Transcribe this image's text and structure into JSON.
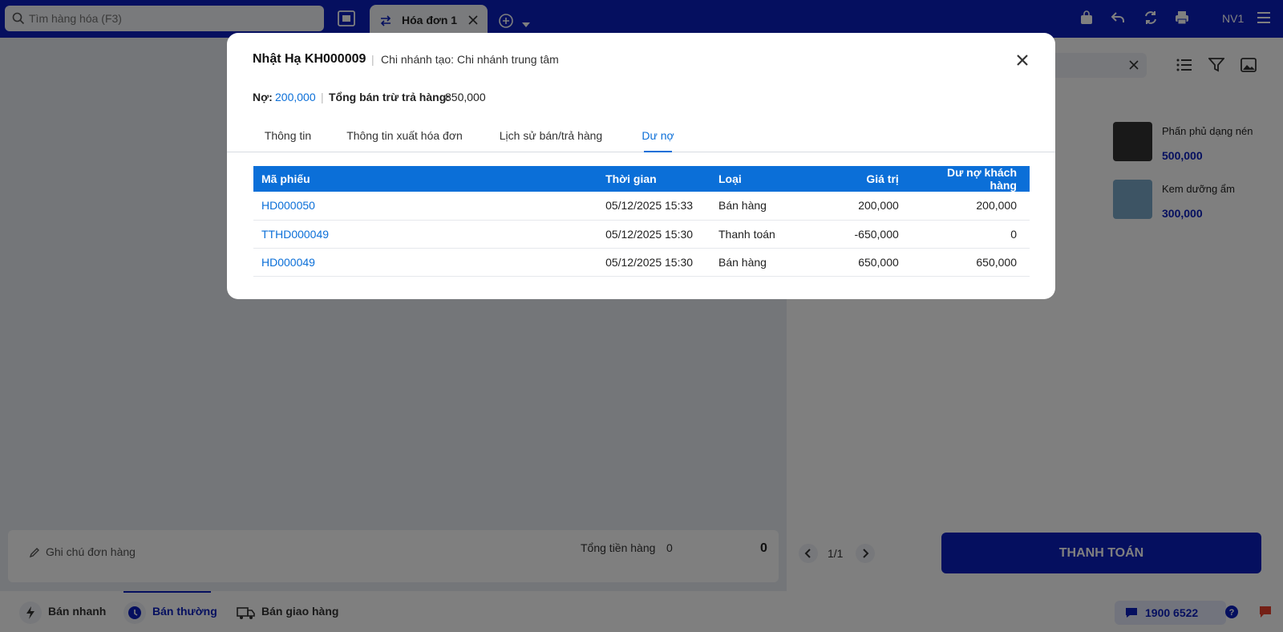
{
  "topbar": {
    "search_placeholder": "Tìm hàng hóa (F3)",
    "invoice_tab_label": "Hóa đơn 1",
    "user": "NV1"
  },
  "products": [
    {
      "name": "Phấn phủ dạng nén",
      "price": "500,000"
    },
    {
      "name": "Kem dưỡng ẩm",
      "price": "300,000"
    }
  ],
  "order": {
    "note_placeholder": "Ghi chú đơn hàng",
    "total_label": "Tổng tiền hàng",
    "total_qty": "0",
    "total_amount": "0"
  },
  "pager": {
    "text": "1/1"
  },
  "pay_button": "THANH TOÁN",
  "bottom_modes": [
    "Bán nhanh",
    "Bán thường",
    "Bán giao hàng"
  ],
  "hotline": "1900 6522",
  "modal": {
    "customer": "Nhật Hạ KH000009",
    "branch": "Chi nhánh tạo: Chi nhánh trung tâm",
    "debt_label": "Nợ:",
    "debt_value": "200,000",
    "net_sales_label": "Tổng bán trừ trả hàng:",
    "net_sales_value": "850,000",
    "tabs": [
      "Thông tin",
      "Thông tin xuất hóa đơn",
      "Lịch sử bán/trả hàng",
      "Dư nợ"
    ],
    "active_tab": 3,
    "table": {
      "headers": [
        "Mã phiếu",
        "Thời gian",
        "Loại",
        "Giá trị",
        "Dư nợ khách hàng"
      ],
      "rows": [
        [
          "HD000050",
          "05/12/2025 15:33",
          "Bán hàng",
          "200,000",
          "200,000"
        ],
        [
          "TTHD000049",
          "05/12/2025 15:30",
          "Thanh toán",
          "-650,000",
          "0"
        ],
        [
          "HD000049",
          "05/12/2025 15:30",
          "Bán hàng",
          "650,000",
          "650,000"
        ]
      ]
    }
  },
  "colors": {
    "brand": "#0b1fbf",
    "accent": "#0b6fd8"
  }
}
